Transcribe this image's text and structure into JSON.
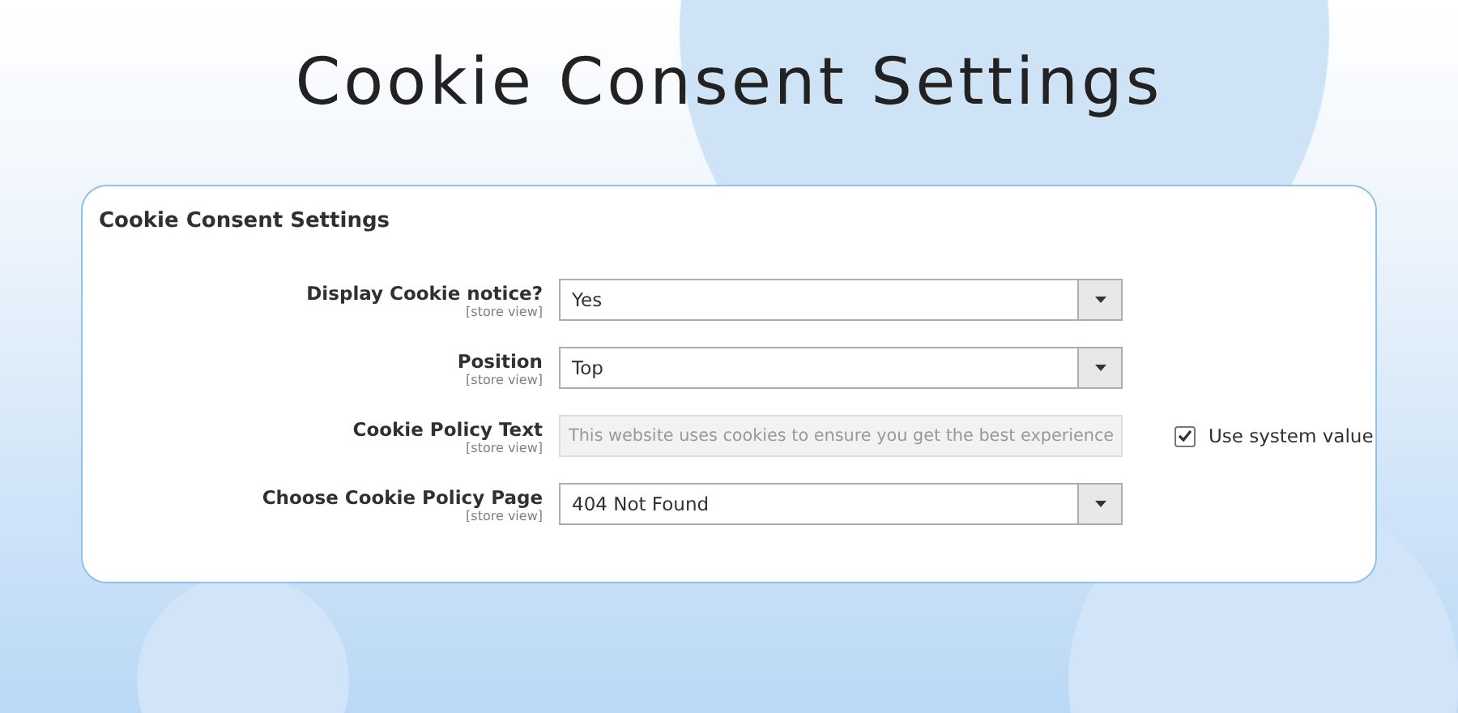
{
  "heading": "Cookie Consent Settings",
  "panel": {
    "title": "Cookie Consent Settings",
    "fields": [
      {
        "label": "Display Cookie notice?",
        "scope": "[store view]",
        "kind": "select",
        "value": "Yes",
        "disabled": false
      },
      {
        "label": "Position",
        "scope": "[store view]",
        "kind": "select",
        "value": "Top",
        "disabled": false
      },
      {
        "label": "Cookie Policy Text",
        "scope": "[store view]",
        "kind": "text",
        "value": "This website uses cookies to ensure you get the best experience",
        "disabled": true,
        "use_system_value": {
          "label": "Use system value",
          "checked": true
        }
      },
      {
        "label": "Choose Cookie Policy Page",
        "scope": "[store view]",
        "kind": "select",
        "value": "404 Not Found",
        "disabled": false
      }
    ]
  }
}
